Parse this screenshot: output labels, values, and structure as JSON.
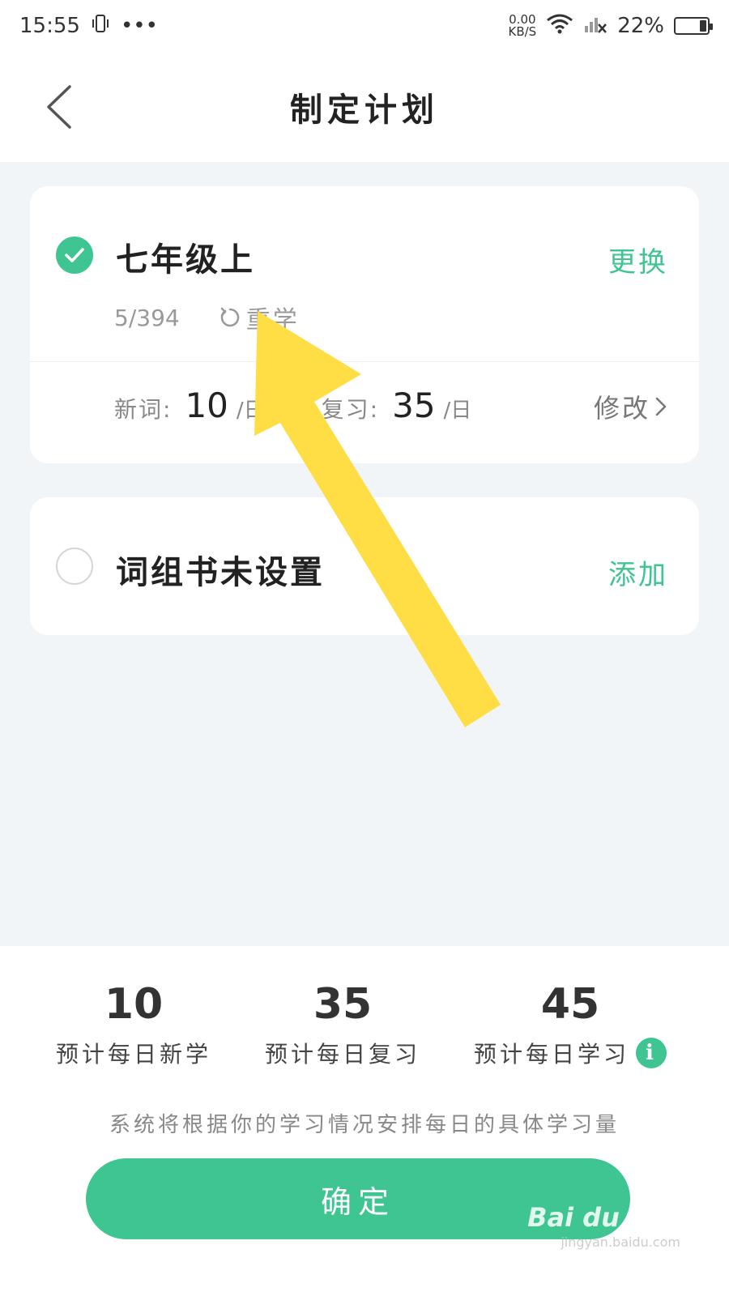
{
  "status_bar": {
    "time": "15:55",
    "more": "•••",
    "net_speed": "0.00",
    "net_unit": "KB/S",
    "battery": "22%",
    "battery_level": 0.22
  },
  "header": {
    "title": "制定计划"
  },
  "book_card": {
    "name": "七年级上",
    "change_label": "更换",
    "progress": "5/394",
    "relearn_label": "重学",
    "new_words_label": "新词:",
    "new_words_value": "10",
    "new_words_unit": "/日",
    "review_label": "复习:",
    "review_value": "35",
    "review_unit": "/日",
    "modify_label": "修改"
  },
  "phrase_card": {
    "name": "词组书未设置",
    "add_label": "添加"
  },
  "summary": {
    "daily_new_value": "10",
    "daily_new_label": "预计每日新学",
    "daily_review_value": "35",
    "daily_review_label": "预计每日复习",
    "daily_total_value": "45",
    "daily_total_label": "预计每日学习",
    "hint": "系统将根据你的学习情况安排每日的具体学习量"
  },
  "confirm_label": "确定",
  "watermark": {
    "main": "Bai du 经验",
    "sub": "jingyan.baidu.com"
  },
  "colors": {
    "accent": "#3ec591",
    "arrow": "#ffdd44",
    "page_bg": "#f2f5f8"
  }
}
